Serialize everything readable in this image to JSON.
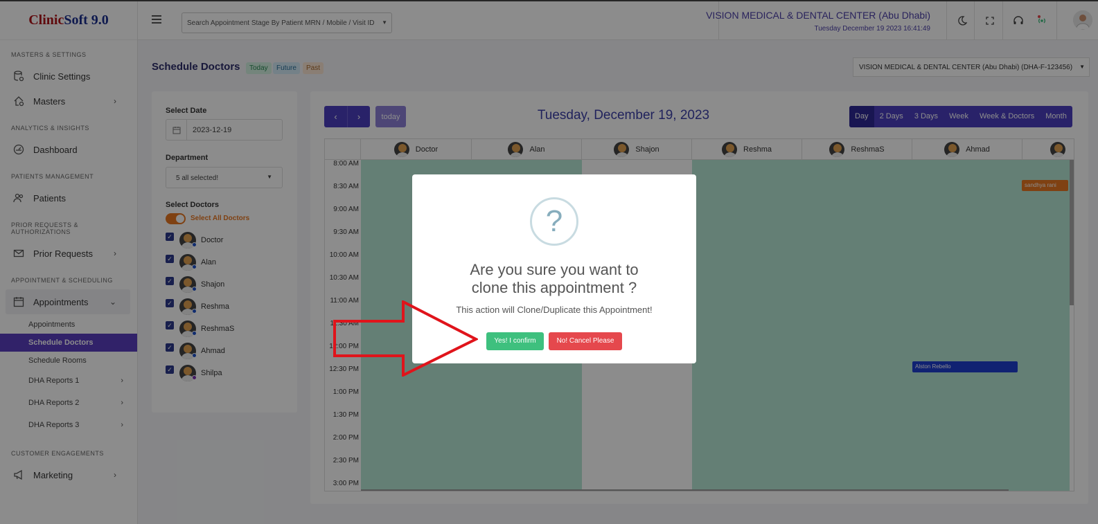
{
  "brand": {
    "part1": "Clinic",
    "part2": "Soft 9.0"
  },
  "sidebar": {
    "sections": [
      "MASTERS & SETTINGS",
      "ANALYTICS & INSIGHTS",
      "PATIENTS MANAGEMENT",
      "PRIOR REQUESTS & AUTHORIZATIONS",
      "APPOINTMENT & SCHEDULING",
      "CUSTOMER ENGAGEMENTS"
    ],
    "items": {
      "clinic_settings": "Clinic Settings",
      "masters": "Masters",
      "dashboard": "Dashboard",
      "patients": "Patients",
      "prior_requests": "Prior Requests",
      "appointments": "Appointments",
      "marketing": "Marketing"
    },
    "sub_items": [
      "Appointments",
      "Schedule Doctors",
      "Schedule Rooms",
      "DHA Reports 1",
      "DHA Reports 2",
      "DHA Reports 3"
    ]
  },
  "header": {
    "search_placeholder": "Search Appointment Stage By Patient MRN / Mobile / Visit ID",
    "clinic_name": "VISION MEDICAL & DENTAL CENTER (Abu Dhabi)",
    "datetime": "Tuesday December 19 2023 16:41:49"
  },
  "page": {
    "title": "Schedule Doctors",
    "pills": [
      "Today",
      "Future",
      "Past"
    ],
    "clinic_select": "VISION MEDICAL & DENTAL CENTER (Abu Dhabi) (DHA-F-123456)"
  },
  "filters": {
    "date_label": "Select Date",
    "date_value": "2023-12-19",
    "department_label": "Department",
    "department_value": "5 all selected!",
    "doctors_label": "Select Doctors",
    "select_all": "Select All Doctors",
    "doctors": [
      "Doctor",
      "Alan",
      "Shajon",
      "Reshma",
      "ReshmaS",
      "Ahmad",
      "Shilpa"
    ]
  },
  "calendar": {
    "today_label": "today",
    "title": "Tuesday, December 19, 2023",
    "views": [
      "Day",
      "2 Days",
      "3 Days",
      "Week",
      "Week & Doctors",
      "Month"
    ],
    "active_view": "Day",
    "columns": [
      "Doctor",
      "Alan",
      "Shajon",
      "Reshma",
      "ReshmaS",
      "Ahmad"
    ],
    "times": [
      "8:00 AM",
      "8:30 AM",
      "9:00 AM",
      "9:30 AM",
      "10:00 AM",
      "10:30 AM",
      "11:00 AM",
      "11:30 AM",
      "12:00 PM",
      "12:30 PM",
      "1:00 PM",
      "1:30 PM",
      "2:00 PM",
      "2:30 PM",
      "3:00 PM"
    ],
    "events": [
      {
        "name": "sandhya rani",
        "color": "#e87722"
      },
      {
        "name": "Alston Rebello",
        "color": "#1e3fd0"
      }
    ]
  },
  "modal": {
    "icon": "?",
    "title_line1": "Are you sure you want to",
    "title_line2": "clone this appointment ?",
    "text": "This action will Clone/Duplicate this Appointment!",
    "confirm": "Yes! I confirm",
    "cancel": "No! Cancel Please"
  },
  "colors": {
    "accent": "#4b3fc0",
    "confirm": "#3ec07e",
    "cancel": "#e5484d",
    "arrow": "#e0141b"
  }
}
